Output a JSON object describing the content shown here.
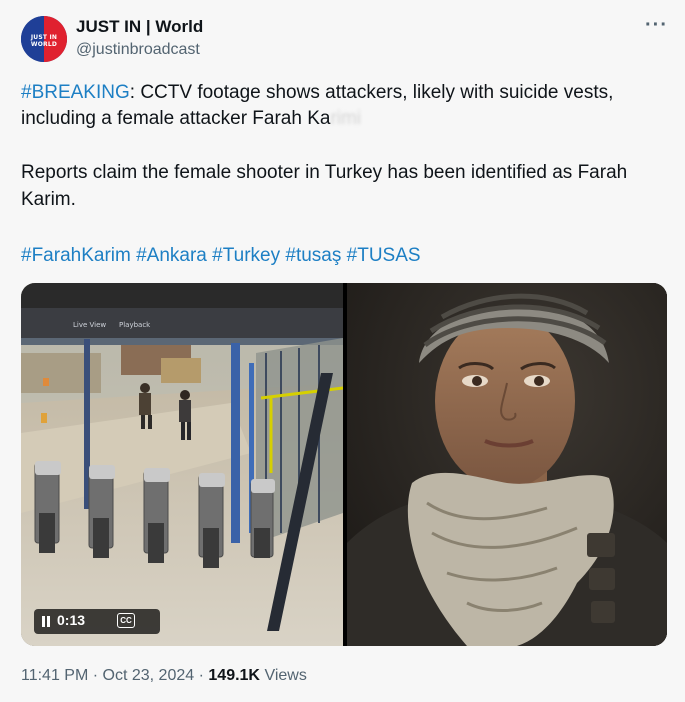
{
  "account": {
    "avatar_text": "JUST IN WORLD",
    "name": "JUST IN | World",
    "handle": "@justinbroadcast"
  },
  "more_label": "···",
  "tweet": {
    "line1_hashtag": "#BREAKING",
    "line1_rest": ": CCTV footage shows attackers, likely with suicide vests,",
    "line2_visible": "including a female attacker Farah Ka",
    "line2_blurred": "rimi",
    "line3": "Reports claim the female shooter in Turkey has been identified as Farah",
    "line4": "Karim.",
    "hashtags": [
      "#FarahKarim",
      "#Ankara",
      "#Turkey",
      "#tusaş",
      "#TUSAS"
    ]
  },
  "video": {
    "tab1": "Live View",
    "tab2": "Playback",
    "time": "0:13",
    "cc_label": "CC"
  },
  "meta": {
    "time": "11:41 PM",
    "date": "Oct 23, 2024",
    "views_count": "149.1K",
    "views_label": "Views"
  },
  "colors": {
    "hashtag": "#1d7fc4",
    "secondary_text": "#536471",
    "primary_text": "#0f1419"
  }
}
